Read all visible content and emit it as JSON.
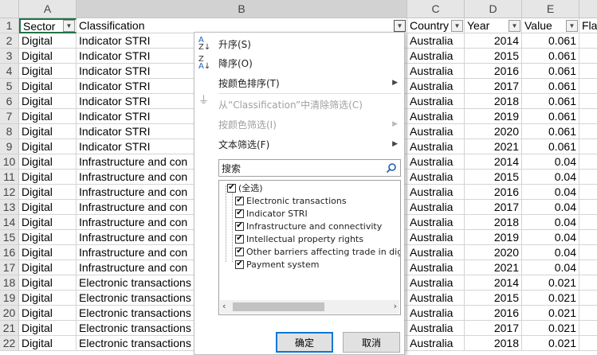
{
  "columns": [
    "A",
    "B",
    "C",
    "D",
    "E"
  ],
  "header_row": {
    "row_num": "1",
    "sector": "Sector",
    "classification": "Classification",
    "country": "Country",
    "year": "Year",
    "value": "Value",
    "flag": "Flag"
  },
  "rows": [
    {
      "n": "2",
      "sector": "Digital",
      "cls": "Indicator STRI",
      "country": "Australia",
      "year": "2014",
      "value": "0.061"
    },
    {
      "n": "3",
      "sector": "Digital",
      "cls": "Indicator STRI",
      "country": "Australia",
      "year": "2015",
      "value": "0.061"
    },
    {
      "n": "4",
      "sector": "Digital",
      "cls": "Indicator STRI",
      "country": "Australia",
      "year": "2016",
      "value": "0.061"
    },
    {
      "n": "5",
      "sector": "Digital",
      "cls": "Indicator STRI",
      "country": "Australia",
      "year": "2017",
      "value": "0.061"
    },
    {
      "n": "6",
      "sector": "Digital",
      "cls": "Indicator STRI",
      "country": "Australia",
      "year": "2018",
      "value": "0.061"
    },
    {
      "n": "7",
      "sector": "Digital",
      "cls": "Indicator STRI",
      "country": "Australia",
      "year": "2019",
      "value": "0.061"
    },
    {
      "n": "8",
      "sector": "Digital",
      "cls": "Indicator STRI",
      "country": "Australia",
      "year": "2020",
      "value": "0.061"
    },
    {
      "n": "9",
      "sector": "Digital",
      "cls": "Indicator STRI",
      "country": "Australia",
      "year": "2021",
      "value": "0.061"
    },
    {
      "n": "10",
      "sector": "Digital",
      "cls": "Infrastructure and con",
      "country": "Australia",
      "year": "2014",
      "value": "0.04"
    },
    {
      "n": "11",
      "sector": "Digital",
      "cls": "Infrastructure and con",
      "country": "Australia",
      "year": "2015",
      "value": "0.04"
    },
    {
      "n": "12",
      "sector": "Digital",
      "cls": "Infrastructure and con",
      "country": "Australia",
      "year": "2016",
      "value": "0.04"
    },
    {
      "n": "13",
      "sector": "Digital",
      "cls": "Infrastructure and con",
      "country": "Australia",
      "year": "2017",
      "value": "0.04"
    },
    {
      "n": "14",
      "sector": "Digital",
      "cls": "Infrastructure and con",
      "country": "Australia",
      "year": "2018",
      "value": "0.04"
    },
    {
      "n": "15",
      "sector": "Digital",
      "cls": "Infrastructure and con",
      "country": "Australia",
      "year": "2019",
      "value": "0.04"
    },
    {
      "n": "16",
      "sector": "Digital",
      "cls": "Infrastructure and con",
      "country": "Australia",
      "year": "2020",
      "value": "0.04"
    },
    {
      "n": "17",
      "sector": "Digital",
      "cls": "Infrastructure and con",
      "country": "Australia",
      "year": "2021",
      "value": "0.04"
    },
    {
      "n": "18",
      "sector": "Digital",
      "cls": "Electronic transactions",
      "country": "Australia",
      "year": "2014",
      "value": "0.021"
    },
    {
      "n": "19",
      "sector": "Digital",
      "cls": "Electronic transactions",
      "country": "Australia",
      "year": "2015",
      "value": "0.021"
    },
    {
      "n": "20",
      "sector": "Digital",
      "cls": "Electronic transactions",
      "country": "Australia",
      "year": "2016",
      "value": "0.021"
    },
    {
      "n": "21",
      "sector": "Digital",
      "cls": "Electronic transactions",
      "country": "Australia",
      "year": "2017",
      "value": "0.021"
    },
    {
      "n": "22",
      "sector": "Digital",
      "cls": "Electronic transactions",
      "country": "Australia",
      "year": "2018",
      "value": "0.021"
    }
  ],
  "menu": {
    "sort_asc": "升序(S)",
    "sort_desc": "降序(O)",
    "sort_by_color": "按颜色排序(T)",
    "clear_filter": "从“Classification”中清除筛选(C)",
    "filter_by_color": "按颜色筛选(I)",
    "text_filter": "文本筛选(F)",
    "search_placeholder": "搜索",
    "items": [
      "(全选)",
      "Electronic transactions",
      "Indicator STRI",
      "Infrastructure and connectivity",
      "Intellectual property rights",
      "Other barriers affecting trade in digit",
      "Payment system"
    ],
    "ok": "确定",
    "cancel": "取消"
  },
  "colors": {
    "header_bg": "#e6e6e6",
    "accent": "#0078d7",
    "grid_line": "#d4d4d4"
  }
}
